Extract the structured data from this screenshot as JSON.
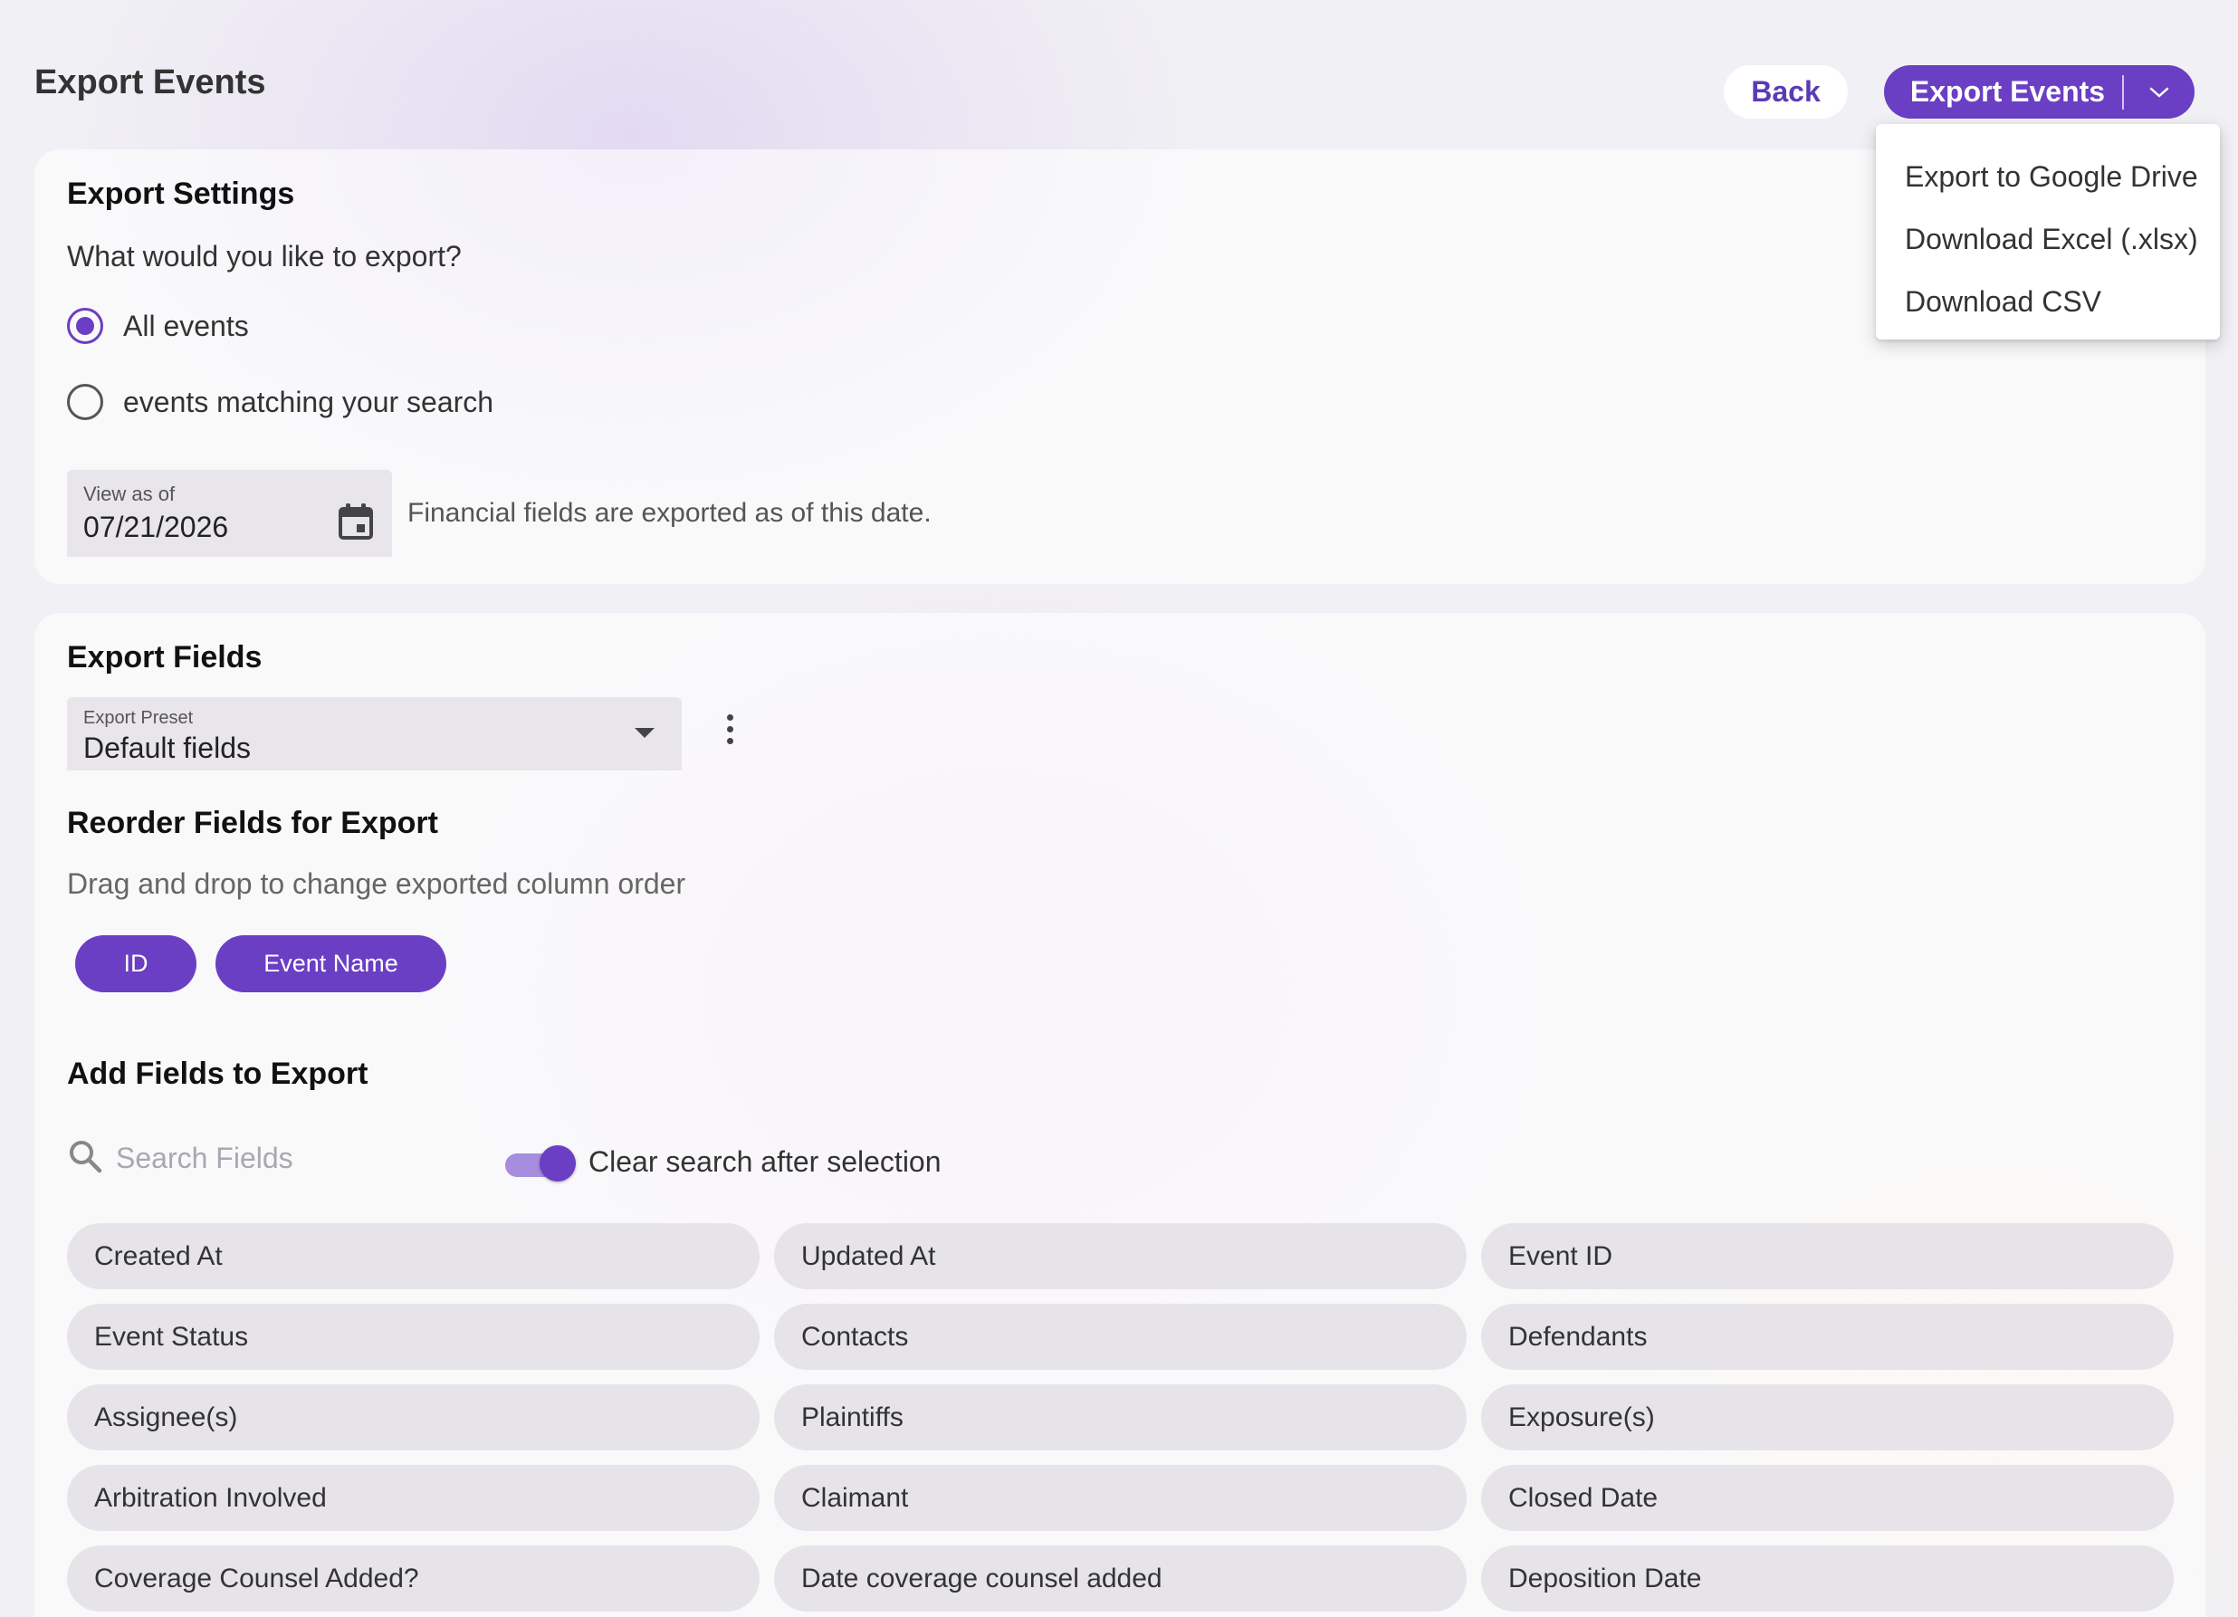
{
  "header": {
    "title": "Export Events",
    "back_label": "Back",
    "export_label": "Export Events"
  },
  "export_menu": {
    "items": [
      "Export to Google Drive",
      "Download Excel (.xlsx)",
      "Download CSV"
    ]
  },
  "settings": {
    "title": "Export Settings",
    "question": "What would you like to export?",
    "options": [
      {
        "label": "All events",
        "selected": true
      },
      {
        "label": "events matching your search",
        "selected": false
      }
    ],
    "date_label": "View as of",
    "date_value": "07/21/2026",
    "date_hint": "Financial fields are exported as of this date."
  },
  "fields": {
    "title": "Export Fields",
    "preset_label": "Export Preset",
    "preset_value": "Default fields",
    "reorder_title": "Reorder Fields for Export",
    "reorder_hint": "Drag and drop to change exported column order",
    "selected": [
      "ID",
      "Event Name"
    ],
    "add_title": "Add Fields to Export",
    "search_placeholder": "Search Fields",
    "clear_toggle_label": "Clear search after selection",
    "clear_toggle_on": true,
    "available": [
      "Created At",
      "Updated At",
      "Event ID",
      "Event Status",
      "Contacts",
      "Defendants",
      "Assignee(s)",
      "Plaintiffs",
      "Exposure(s)",
      "Arbitration Involved",
      "Claimant",
      "Closed Date",
      "Coverage Counsel Added?",
      "Date coverage counsel added",
      "Deposition Date"
    ]
  },
  "colors": {
    "accent": "#6a3fc4",
    "toggle_track": "#a68de0",
    "pill_bg": "#e6e4e8"
  }
}
